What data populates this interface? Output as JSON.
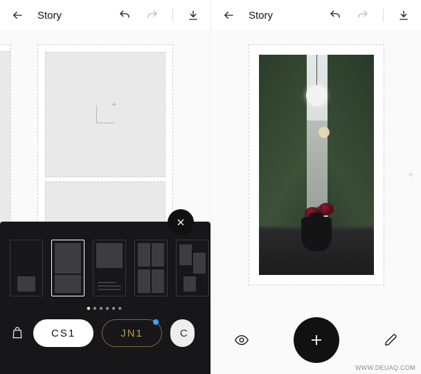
{
  "left": {
    "title": "Story",
    "topbar_icons": {
      "back": "back-icon",
      "undo": "undo-icon",
      "redo": "redo-icon",
      "download": "download-icon"
    },
    "sheet": {
      "close": "close-icon",
      "page_dots_total": 6,
      "page_dots_active_index": 0,
      "shop_icon": "shopping-bag-icon",
      "packs": [
        {
          "label": "CS1",
          "style": "active"
        },
        {
          "label": "JN1",
          "style": "outlined",
          "has_notification": true
        },
        {
          "label": "C",
          "style": "peek"
        }
      ]
    }
  },
  "right": {
    "title": "Story",
    "topbar_icons": {
      "back": "back-icon",
      "undo": "undo-icon",
      "redo": "redo-icon",
      "download": "download-icon"
    },
    "tools": {
      "preview": "eye-icon",
      "add": "plus-icon",
      "edit": "pencil-icon"
    },
    "side_add": "+"
  },
  "watermark": "WWW.DEUAQ.COM"
}
